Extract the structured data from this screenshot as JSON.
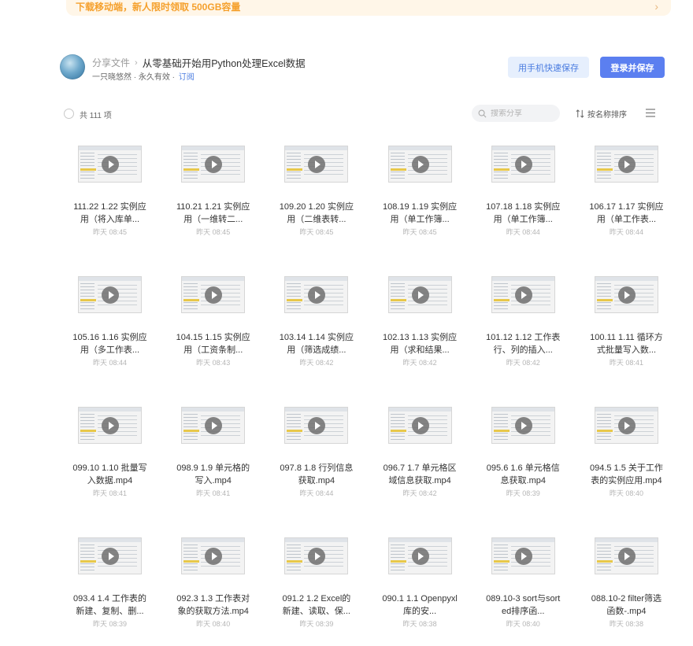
{
  "banner": {
    "text": "下载移动端，新人限时领取 500GB容量",
    "arrow": "›"
  },
  "header": {
    "breadcrumb_root": "分享文件",
    "breadcrumb_sep": "›",
    "title": "从零基础开始用Python处理Excel数据",
    "owner_info": "一只晓悠然 · 永久有效 · ",
    "subscribe_label": "订阅",
    "phone_save_label": "用手机快速保存",
    "login_save_label": "登录并保存"
  },
  "toolbar": {
    "count": "共 111 项",
    "search_placeholder": "搜索分享",
    "sort_label": "按名称排序"
  },
  "colors": {
    "accent": "#5b7ff0",
    "banner_text": "#f5a02c",
    "link": "#4a7ce0"
  },
  "files": [
    {
      "name": "111.22 1.22 实例应用（将入库单...",
      "time": "昨天 08:45"
    },
    {
      "name": "110.21 1.21 实例应用（一维转二...",
      "time": "昨天 08:45"
    },
    {
      "name": "109.20 1.20 实例应用（二维表转...",
      "time": "昨天 08:45"
    },
    {
      "name": "108.19 1.19 实例应用（单工作簿...",
      "time": "昨天 08:45"
    },
    {
      "name": "107.18 1.18 实例应用（单工作簿...",
      "time": "昨天 08:44"
    },
    {
      "name": "106.17 1.17 实例应用（单工作表...",
      "time": "昨天 08:44"
    },
    {
      "name": "105.16 1.16 实例应用（多工作表...",
      "time": "昨天 08:44"
    },
    {
      "name": "104.15 1.15 实例应用（工资条制...",
      "time": "昨天 08:43"
    },
    {
      "name": "103.14 1.14 实例应用（筛选成绩...",
      "time": "昨天 08:42"
    },
    {
      "name": "102.13 1.13 实例应用（求和结果...",
      "time": "昨天 08:42"
    },
    {
      "name": "101.12 1.12 工作表行、列的插入...",
      "time": "昨天 08:42"
    },
    {
      "name": "100.11 1.11 循环方式批量写入数...",
      "time": "昨天 08:41"
    },
    {
      "name": "099.10 1.10 批量写入数据.mp4",
      "time": "昨天 08:41"
    },
    {
      "name": "098.9 1.9 单元格的写入.mp4",
      "time": "昨天 08:41"
    },
    {
      "name": "097.8 1.8 行列信息获取.mp4",
      "time": "昨天 08:44"
    },
    {
      "name": "096.7 1.7 单元格区域信息获取.mp4",
      "time": "昨天 08:42"
    },
    {
      "name": "095.6 1.6 单元格信息获取.mp4",
      "time": "昨天 08:39"
    },
    {
      "name": "094.5 1.5 关于工作表的实例应用.mp4",
      "time": "昨天 08:40"
    },
    {
      "name": "093.4 1.4 工作表的新建、复制、删...",
      "time": "昨天 08:39"
    },
    {
      "name": "092.3 1.3 工作表对象的获取方法.mp4",
      "time": "昨天 08:40"
    },
    {
      "name": "091.2 1.2 Excel的新建、读取、保...",
      "time": "昨天 08:39"
    },
    {
      "name": "090.1 1.1 Openpyxl库的安...",
      "time": "昨天 08:38"
    },
    {
      "name": "089.10-3 sort与sorted排序函...",
      "time": "昨天 08:40"
    },
    {
      "name": "088.10-2 filter筛选函数-.mp4",
      "time": "昨天 08:38"
    }
  ]
}
